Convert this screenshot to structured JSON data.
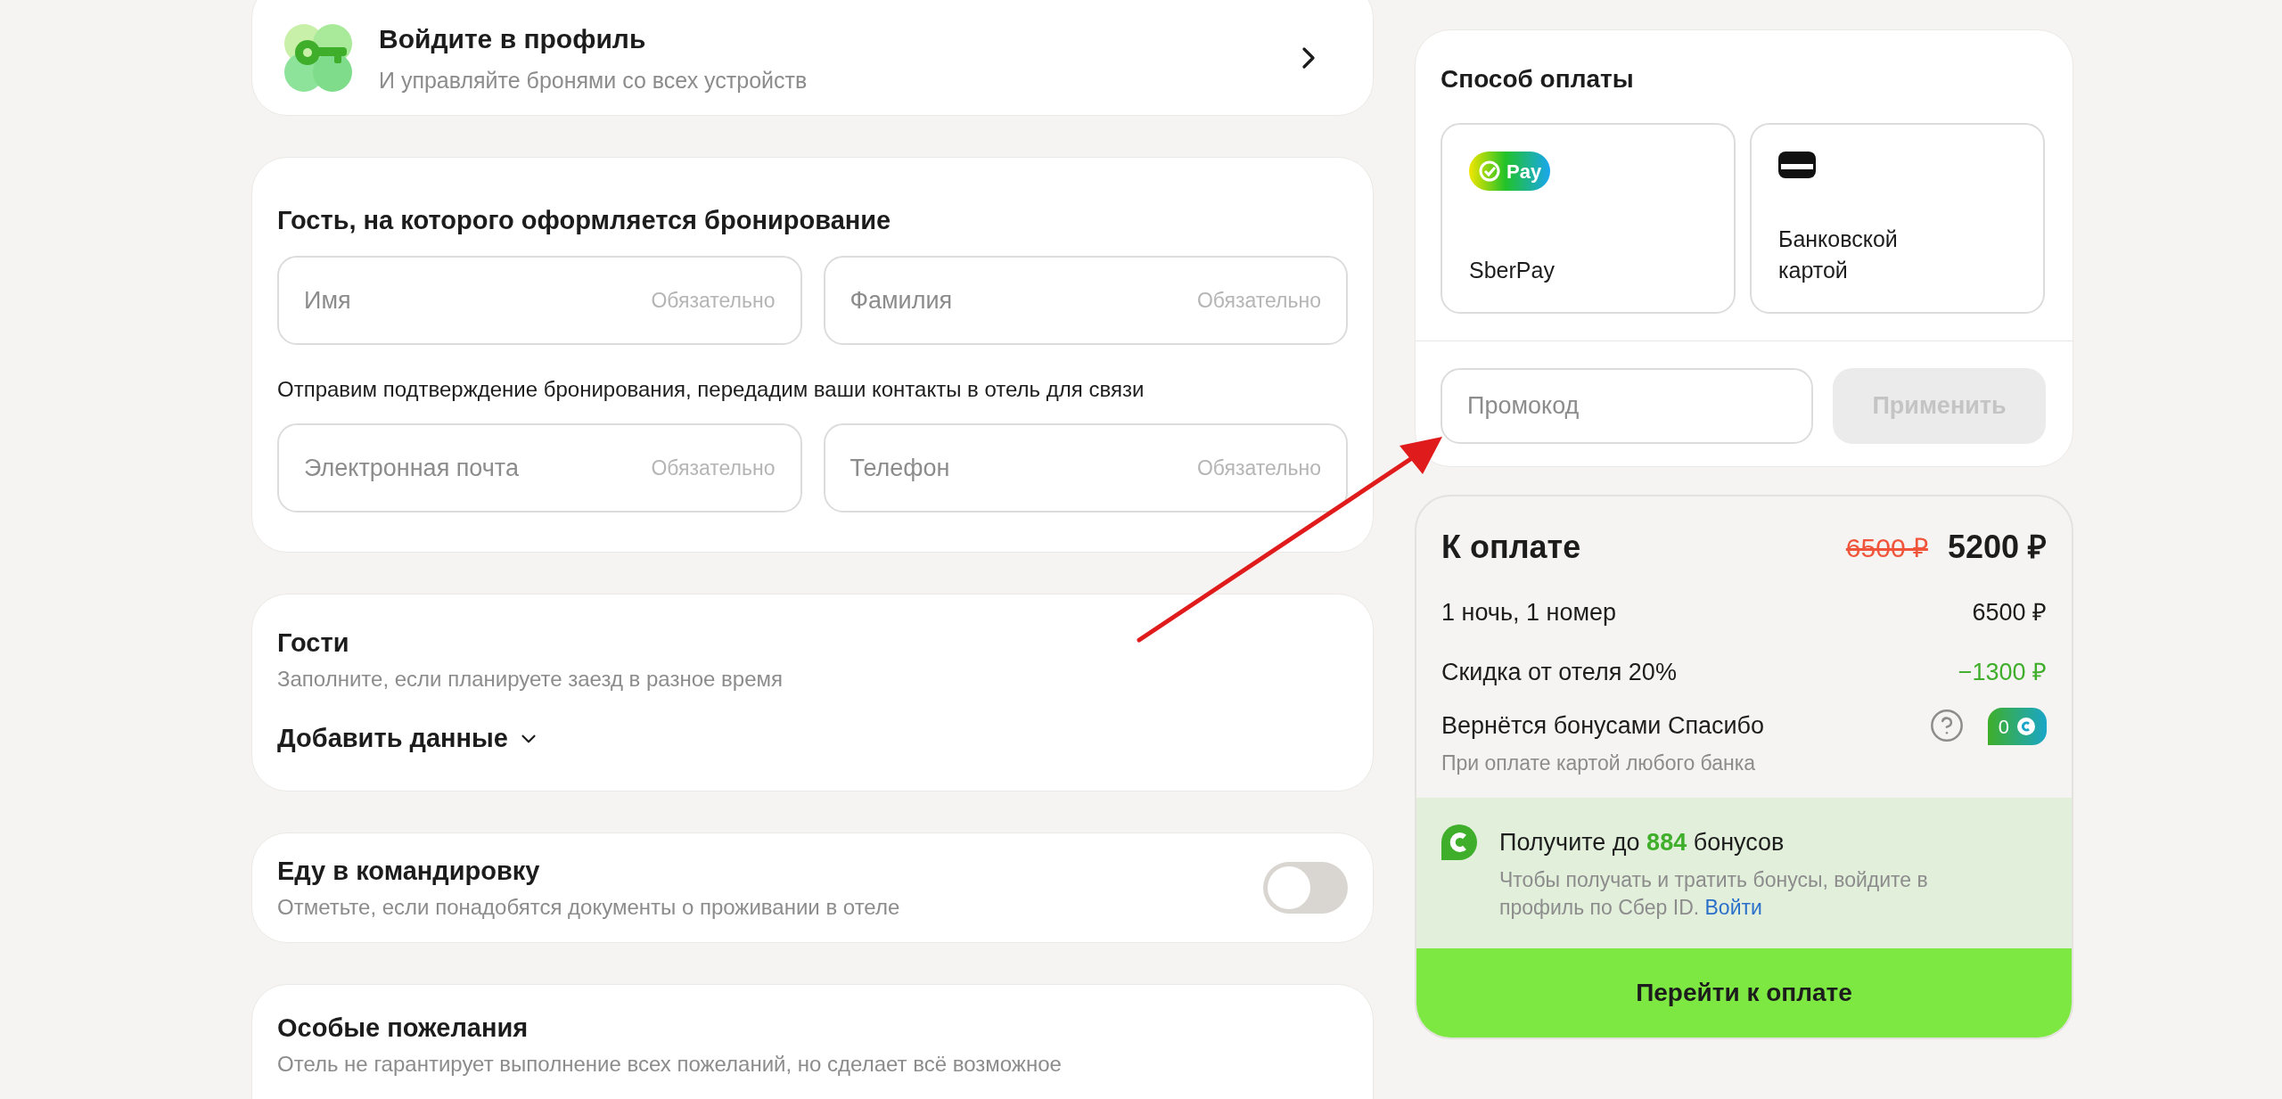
{
  "profile": {
    "title": "Войдите в профиль",
    "subtitle": "И управляйте бронями со всех устройств"
  },
  "guest_form": {
    "title": "Гость, на которого оформляется бронирование",
    "name_fields": [
      {
        "placeholder": "Имя",
        "required_label": "Обязательно"
      },
      {
        "placeholder": "Фамилия",
        "required_label": "Обязательно"
      }
    ],
    "note": "Отправим подтверждение бронирования, передадим ваши контакты в отель для связи",
    "contact_fields": [
      {
        "placeholder": "Электронная почта",
        "required_label": "Обязательно"
      },
      {
        "placeholder": "Телефон",
        "required_label": "Обязательно"
      }
    ]
  },
  "guests": {
    "title": "Гости",
    "subtitle": "Заполните, если планируете заезд в разное время",
    "expander": {
      "label": "Добавить данные",
      "expanded": false
    }
  },
  "business_trip": {
    "title": "Еду в командировку",
    "subtitle": "Отметьте, если понадобятся документы о проживании в отеле",
    "on": false
  },
  "wishes": {
    "title": "Особые пожелания",
    "subtitle": "Отель не гарантирует выполнение всех пожеланий, но сделает всё возможное"
  },
  "payment": {
    "title": "Способ оплаты",
    "options": [
      {
        "kind": "sberpay",
        "badge": "Pay",
        "label": "SberPay",
        "selected": false
      },
      {
        "kind": "card",
        "label": "Банковской картой",
        "selected": false
      }
    ],
    "promo": {
      "placeholder": "Промокод",
      "button": "Применить",
      "disabled": true
    }
  },
  "total": {
    "title": "К оплате",
    "old_price": "6500 ₽",
    "price": "5200 ₽",
    "rows": [
      {
        "label": "1 ночь, 1 номер",
        "value": "6500 ₽",
        "kind": "plain"
      },
      {
        "label": "Скидка от отеля 20%",
        "value": "−1300 ₽",
        "kind": "discount"
      }
    ],
    "bonus_row": {
      "label": "Вернётся бонусами Спасибо",
      "note": "При оплате картой любого банка",
      "badge": "0"
    },
    "promo_block": {
      "before": "Получите до",
      "amount": "884",
      "after": "бонусов",
      "text": "Чтобы получать и тратить бонусы, войдите в профиль по Сбер ID.",
      "link": "Войти"
    },
    "button": "Перейти к оплате"
  }
}
